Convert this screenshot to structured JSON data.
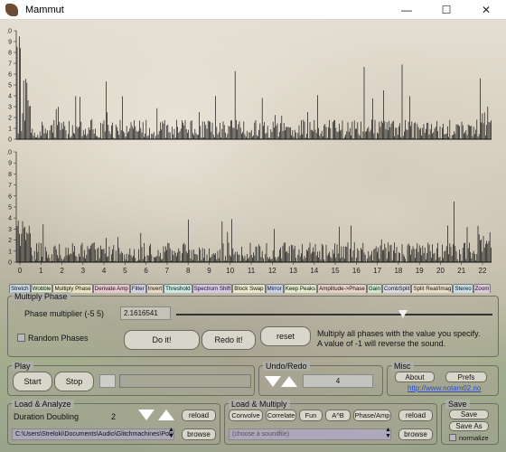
{
  "window": {
    "title": "Mammut",
    "minimize": "—",
    "maximize": "☐",
    "close": "✕"
  },
  "plots": {
    "y_ticks": [
      "0",
      "1",
      "2",
      "3",
      "4",
      "5",
      "6",
      "7",
      "8",
      "9",
      "10"
    ],
    "x_ticks": [
      "0",
      "1",
      "2",
      "3",
      "4",
      "5",
      "6",
      "7",
      "8",
      "9",
      "10",
      "11",
      "12",
      "13",
      "14",
      "15",
      "16",
      "17",
      "18",
      "19",
      "20",
      "21",
      "22"
    ]
  },
  "tabs": [
    {
      "label": "Stretch",
      "color": "#c8d8e8"
    },
    {
      "label": "Wobble",
      "color": "#d8e8c8"
    },
    {
      "label": "Multiply Phase",
      "color": "#e8e2c0"
    },
    {
      "label": "Derivate Amp",
      "color": "#e8c8d0"
    },
    {
      "label": "Filter",
      "color": "#d0d0e8"
    },
    {
      "label": "Invert",
      "color": "#e8d8c0"
    },
    {
      "label": "Threshold",
      "color": "#c8e8e0"
    },
    {
      "label": "Spectrum Shift",
      "color": "#d8c8e8"
    },
    {
      "label": "Block Swap",
      "color": "#e8e8c8"
    },
    {
      "label": "Mirror",
      "color": "#c8d0e8"
    },
    {
      "label": "Keep Peaks",
      "color": "#e0e8c8"
    },
    {
      "label": "Amplitude->Phase",
      "color": "#e8d0c8"
    },
    {
      "label": "Gain",
      "color": "#c8e8c8"
    },
    {
      "label": "CombSplit",
      "color": "#d8d8e0"
    },
    {
      "label": "Split Real/Imag",
      "color": "#e8dcc8"
    },
    {
      "label": "Stereo",
      "color": "#c8dce8"
    },
    {
      "label": "Zoom",
      "color": "#e0c8e0"
    }
  ],
  "multiply_phase": {
    "title": "Multiply Phase",
    "multiplier_label": "Phase multiplier (-5 5)",
    "multiplier_value": "2.1616541",
    "slider_fraction": 0.716,
    "random_phases_label": "Random Phases",
    "do_it_label": "Do it!",
    "redo_it_label": "Redo it!",
    "reset_label": "reset",
    "description_line1": "Multiply all phases with the value you specify.",
    "description_line2": "A value of -1 will reverse the sound."
  },
  "play": {
    "title": "Play",
    "start_label": "Start",
    "stop_label": "Stop"
  },
  "undo_redo": {
    "title": "Undo/Redo",
    "value": "4"
  },
  "misc": {
    "title": "Misc",
    "about_label": "About",
    "prefs_label": "Prefs",
    "link": "http://www.notam02.no"
  },
  "load_analyze": {
    "title": "Load & Analyze",
    "mode_label": "Duration Doubling",
    "mode_value": "2",
    "reload_label": "reload",
    "path": "C:\\Users\\Streloki\\Documents\\Audio\\Glitchmachines\\Polygon",
    "browse_label": "browse"
  },
  "load_multiply": {
    "title": "Load & Multiply",
    "ops": [
      "Convolve",
      "Correlate",
      "Fun",
      "A^B",
      "Phase/Amp"
    ],
    "reload_label": "reload",
    "placeholder": "(choose a soundfile)",
    "browse_label": "browse"
  },
  "save": {
    "title": "Save",
    "save_label": "Save",
    "save_as_label": "Save As",
    "normalize_label": "normalize"
  },
  "colors": {
    "accent_link": "#2a4cc8",
    "spike": "#111111"
  }
}
